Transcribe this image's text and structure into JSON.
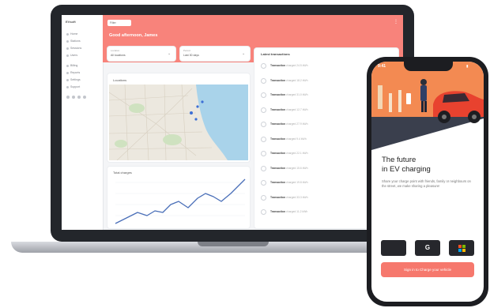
{
  "dashboard": {
    "logo": "EVsoft",
    "nav_items": [
      "Home",
      "Stations",
      "Sessions",
      "Users",
      "Billing",
      "Reports",
      "Settings",
      "Support"
    ],
    "filter_pill": "Filter",
    "header_title": "Good afternoon, James",
    "selector_1": {
      "label": "Location",
      "value": "All locations"
    },
    "selector_2": {
      "label": "Period",
      "value": "Last 30 days"
    },
    "map_title": "Locations",
    "graph_title": "Total charges",
    "latest_title": "Latest transactions",
    "transactions": [
      {
        "name": "Transaction",
        "detail": "charged 24.5 kWh"
      },
      {
        "name": "Transaction",
        "detail": "charged 18.2 kWh"
      },
      {
        "name": "Transaction",
        "detail": "charged 31.0 kWh"
      },
      {
        "name": "Transaction",
        "detail": "charged 12.7 kWh"
      },
      {
        "name": "Transaction",
        "detail": "charged 27.9 kWh"
      },
      {
        "name": "Transaction",
        "detail": "charged 9.4 kWh"
      },
      {
        "name": "Transaction",
        "detail": "charged 22.1 kWh"
      },
      {
        "name": "Transaction",
        "detail": "charged 15.6 kWh"
      },
      {
        "name": "Transaction",
        "detail": "charged 19.8 kWh"
      },
      {
        "name": "Transaction",
        "detail": "charged 33.3 kWh"
      },
      {
        "name": "Transaction",
        "detail": "charged 11.2 kWh"
      }
    ]
  },
  "phone": {
    "time": "9:41",
    "title_line1": "The future",
    "title_line2": "in EV charging",
    "description": "Share your charge point with friends, family or neighbours on the street, we make sharing a pleasure!",
    "cta_label": "Sign in to Charge your vehicle",
    "colors": {
      "accent": "#f6786d",
      "header": "#f8837b"
    }
  }
}
